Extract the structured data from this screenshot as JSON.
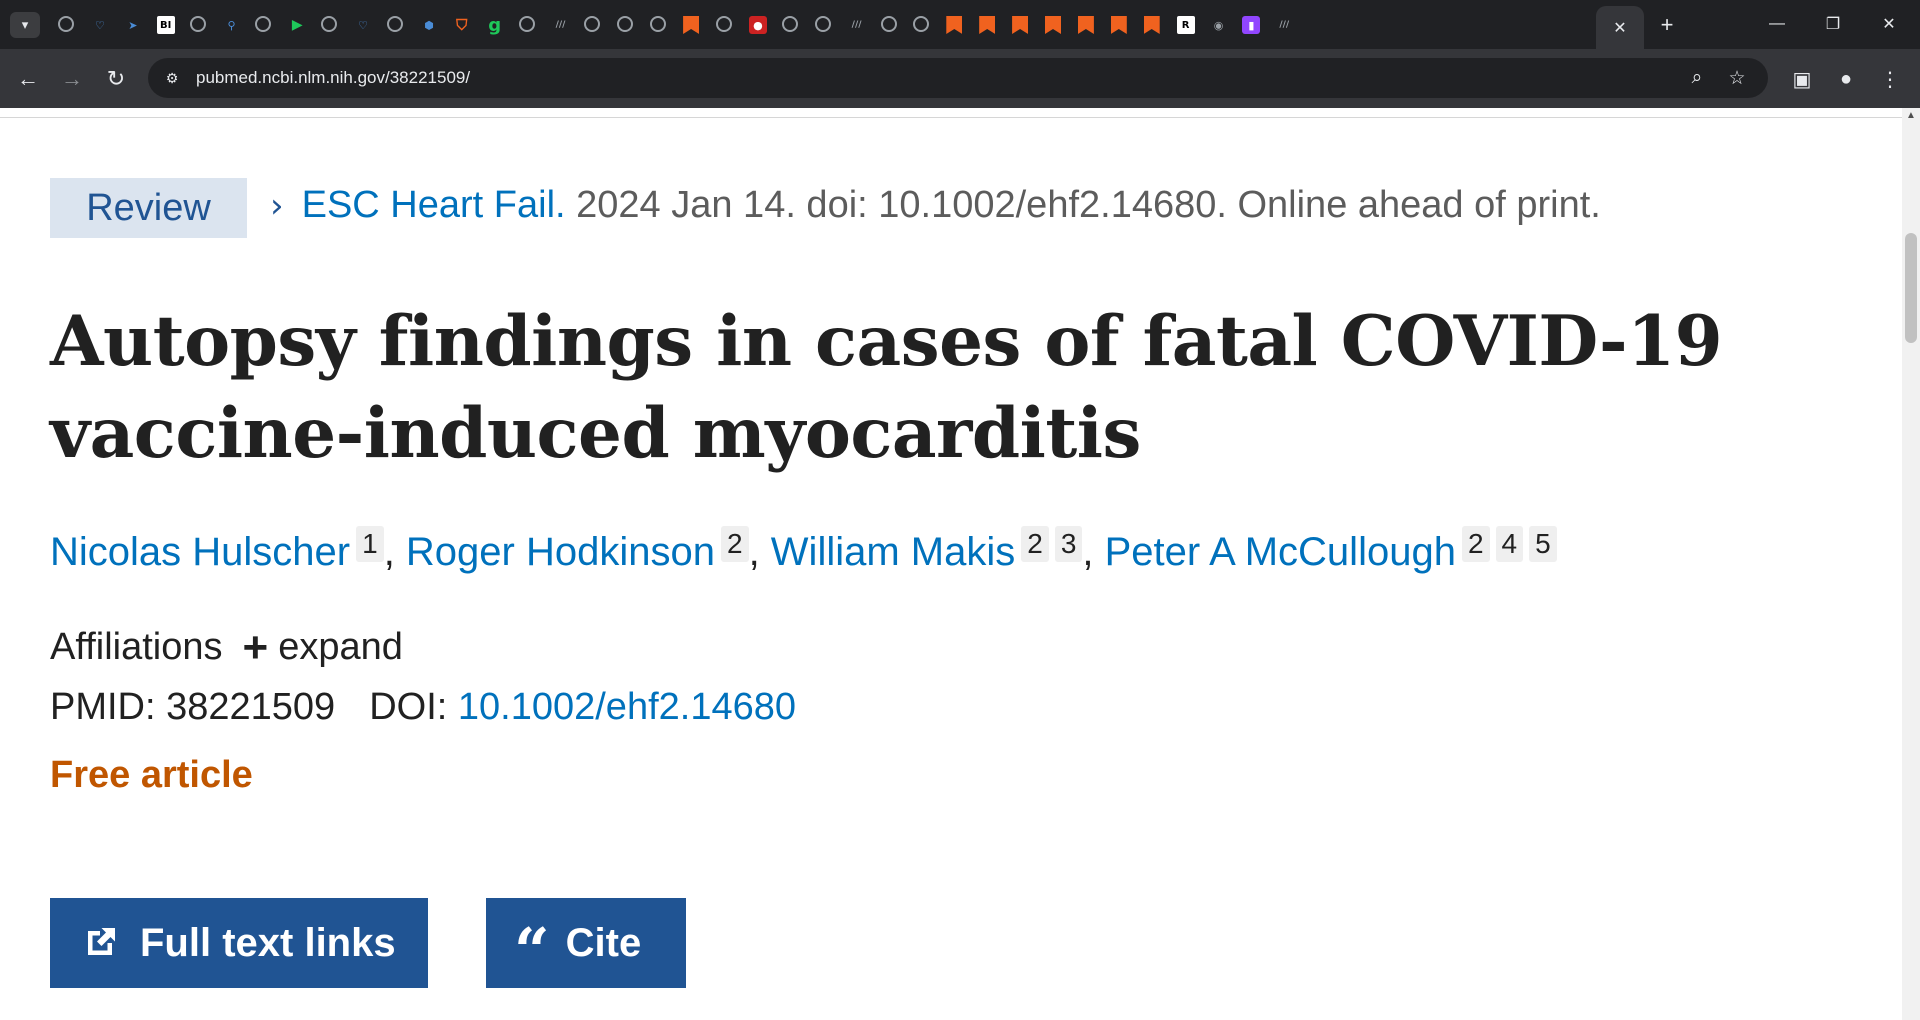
{
  "browser": {
    "url": "pubmed.ncbi.nlm.nih.gov/38221509/",
    "tabs": [
      {
        "icon": "globe-icon"
      },
      {
        "icon": "shield-outline-icon"
      },
      {
        "icon": "arrow-right-icon"
      },
      {
        "icon": "bi-logo-icon",
        "text": "BI"
      },
      {
        "icon": "globe-icon"
      },
      {
        "icon": "magnifier-icon"
      },
      {
        "icon": "globe-icon"
      },
      {
        "icon": "play-circle-icon"
      },
      {
        "icon": "globe-icon"
      },
      {
        "icon": "shield-outline-icon"
      },
      {
        "icon": "globe-icon"
      },
      {
        "icon": "hexagon-icon"
      },
      {
        "icon": "brave-shield-icon"
      },
      {
        "icon": "g-logo-icon",
        "text": "g"
      },
      {
        "icon": "globe-icon"
      },
      {
        "icon": "slash-logo-icon"
      },
      {
        "icon": "globe-icon"
      },
      {
        "icon": "globe-icon"
      },
      {
        "icon": "globe-icon"
      },
      {
        "icon": "substack-bookmark-icon"
      },
      {
        "icon": "globe-icon"
      },
      {
        "icon": "red-mic-icon"
      },
      {
        "icon": "globe-icon"
      },
      {
        "icon": "globe-icon"
      },
      {
        "icon": "slash-logo-icon"
      },
      {
        "icon": "globe-icon"
      },
      {
        "icon": "globe-icon"
      },
      {
        "icon": "substack-bookmark-icon"
      },
      {
        "icon": "substack-bookmark-icon"
      },
      {
        "icon": "substack-bookmark-icon"
      },
      {
        "icon": "substack-bookmark-icon"
      },
      {
        "icon": "substack-bookmark-icon"
      },
      {
        "icon": "substack-bookmark-icon"
      },
      {
        "icon": "substack-bookmark-icon"
      },
      {
        "icon": "rg-logo-icon",
        "text": "R"
      },
      {
        "icon": "dark-logo-icon"
      },
      {
        "icon": "twitch-icon"
      },
      {
        "icon": "slash-logo-icon"
      }
    ]
  },
  "article": {
    "type_badge": "Review",
    "journal": "ESC Heart Fail.",
    "citation_rest": " 2024 Jan 14. doi: 10.1002/ehf2.14680. Online ahead of print.",
    "title": "Autopsy findings in cases of fatal COVID-19 vaccine-induced myocarditis",
    "authors": [
      {
        "name": "Nicolas Hulscher",
        "affiliations": [
          "1"
        ]
      },
      {
        "name": "Roger Hodkinson",
        "affiliations": [
          "2"
        ]
      },
      {
        "name": "William Makis",
        "affiliations": [
          "2",
          "3"
        ]
      },
      {
        "name": "Peter A McCullough",
        "affiliations": [
          "2",
          "4",
          "5"
        ]
      }
    ],
    "affiliations_label": "Affiliations",
    "expand_label": "expand",
    "pmid_label": "PMID: ",
    "pmid": "38221509",
    "doi_label": "DOI: ",
    "doi": "10.1002/ehf2.14680",
    "free_article": "Free article"
  },
  "actions": {
    "full_text_label": "Full text links",
    "cite_label": "Cite"
  },
  "colors": {
    "link": "#0071bc",
    "primary_button": "#205493",
    "free_article": "#c05600",
    "badge_bg": "#dbe4ef"
  }
}
